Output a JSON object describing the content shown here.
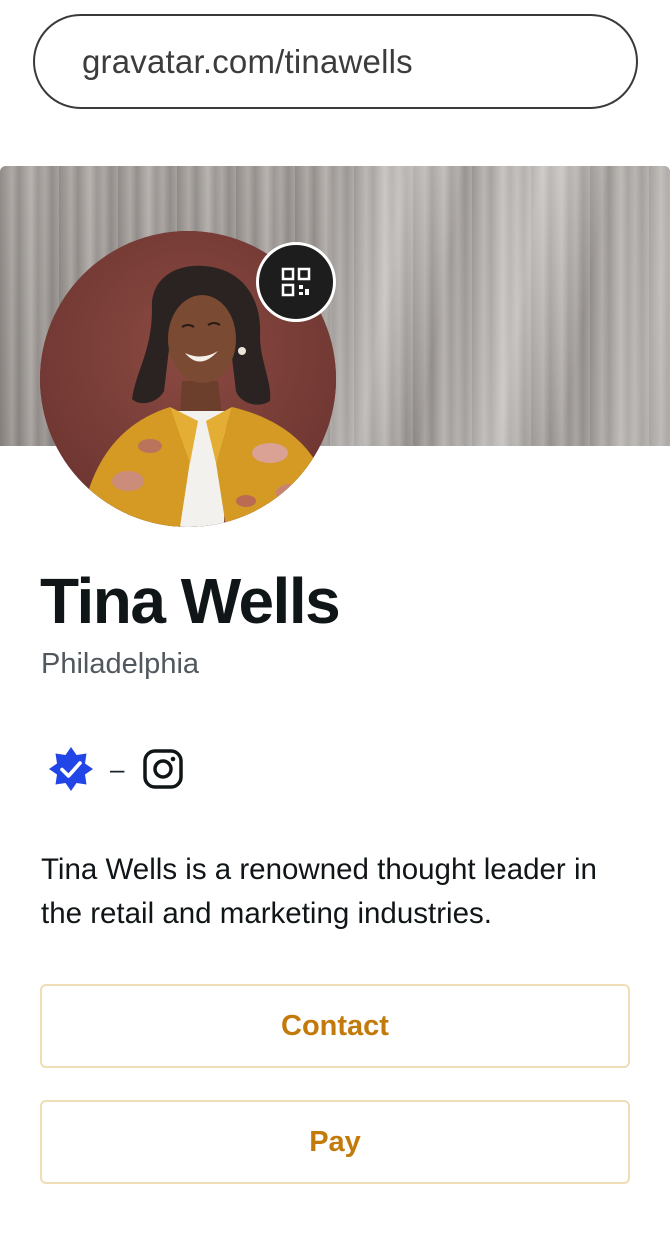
{
  "address_bar": {
    "url": "gravatar.com/tinawells"
  },
  "profile": {
    "name": "Tina Wells",
    "location": "Philadelphia",
    "separator": "–",
    "bio": "Tina Wells is a renowned thought leader in the retail and marketing industries."
  },
  "icons": {
    "qr": "qr-code-icon",
    "verified": "verified-badge-icon",
    "instagram": "instagram-icon"
  },
  "actions": {
    "contact_label": "Contact",
    "pay_label": "Pay"
  },
  "colors": {
    "accent": "#c27a0a",
    "button_border": "#f0ddb7",
    "verified": "#2145e6",
    "text": "#101517",
    "muted": "#50575e"
  }
}
